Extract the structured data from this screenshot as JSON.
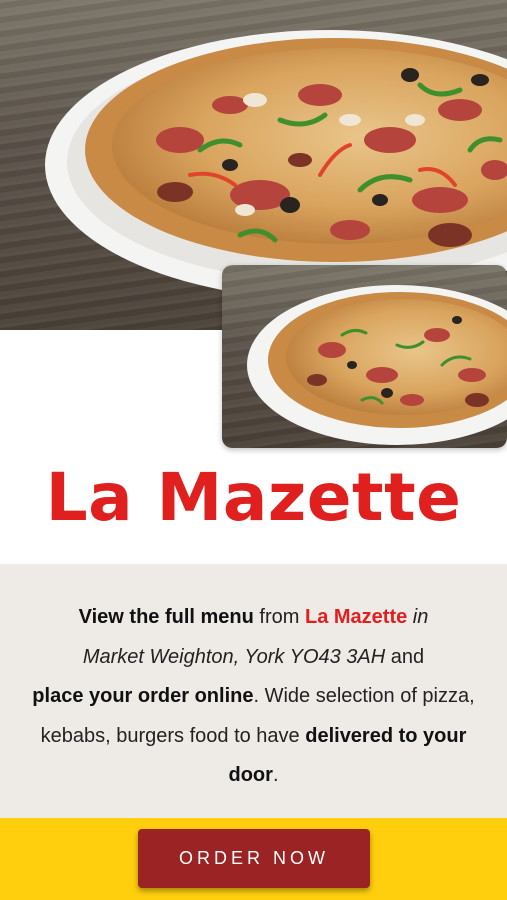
{
  "restaurant": {
    "name": "La Mazette"
  },
  "description": {
    "view_full_menu": "View the full menu",
    "from": " from ",
    "name": "La Mazette",
    "in": " in",
    "location": "Market Weighton, York YO43 3AH",
    "and": " and ",
    "place_order": "place your order online",
    "selection": ". Wide selection of pizza, kebabs, burgers food to have ",
    "delivered": "delivered to your door",
    "end": "."
  },
  "order": {
    "button_label": "ORDER NOW"
  },
  "colors": {
    "brand_red": "#e0201f",
    "button_red": "#9b2323",
    "order_bar_yellow": "#ffcf0d",
    "description_bg": "#eeeae6"
  }
}
